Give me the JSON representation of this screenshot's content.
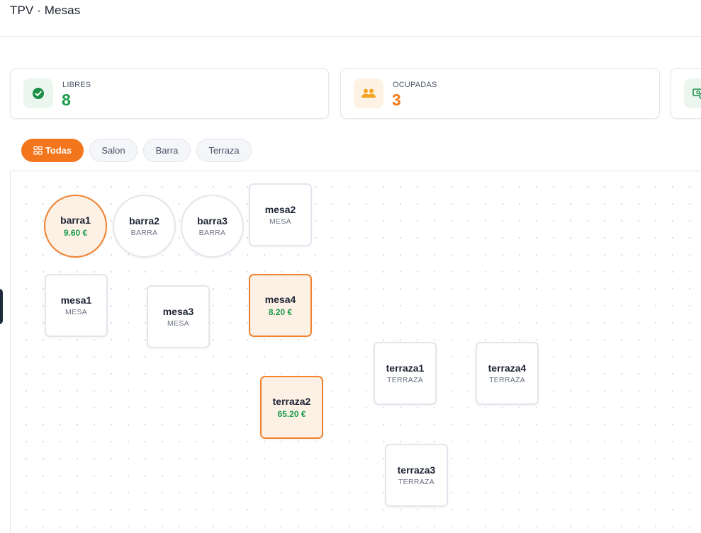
{
  "header": {
    "title": "TPV · Mesas"
  },
  "stats": {
    "free": {
      "label": "LIBRES",
      "value": "8",
      "icon": "check-circle-icon"
    },
    "busy": {
      "label": "OCUPADAS",
      "value": "3",
      "icon": "users-icon"
    },
    "cash": {
      "icon": "cash-icon"
    }
  },
  "filters": [
    {
      "label": "Todas",
      "active": true,
      "icon": "grid-icon"
    },
    {
      "label": "Salon",
      "active": false
    },
    {
      "label": "Barra",
      "active": false
    },
    {
      "label": "Terraza",
      "active": false
    }
  ],
  "tables": {
    "barra1": {
      "name": "barra1",
      "amount": "9.60 €"
    },
    "barra2": {
      "name": "barra2",
      "sub": "BARRA"
    },
    "barra3": {
      "name": "barra3",
      "sub": "BARRA"
    },
    "mesa2": {
      "name": "mesa2",
      "sub": "MESA"
    },
    "mesa1": {
      "name": "mesa1",
      "sub": "MESA"
    },
    "mesa3": {
      "name": "mesa3",
      "sub": "MESA"
    },
    "mesa4": {
      "name": "mesa4",
      "amount": "8.20 €"
    },
    "terraza1": {
      "name": "terraza1",
      "sub": "TERRAZA"
    },
    "terraza4": {
      "name": "terraza4",
      "sub": "TERRAZA"
    },
    "terraza2": {
      "name": "terraza2",
      "amount": "65.20 €"
    },
    "terraza3": {
      "name": "terraza3",
      "sub": "TERRAZA"
    }
  },
  "colors": {
    "accent": "#f4761c",
    "free": "#1a9a4b",
    "occupied_border": "#f2822e",
    "occupied_bg": "#fdf1e6"
  }
}
